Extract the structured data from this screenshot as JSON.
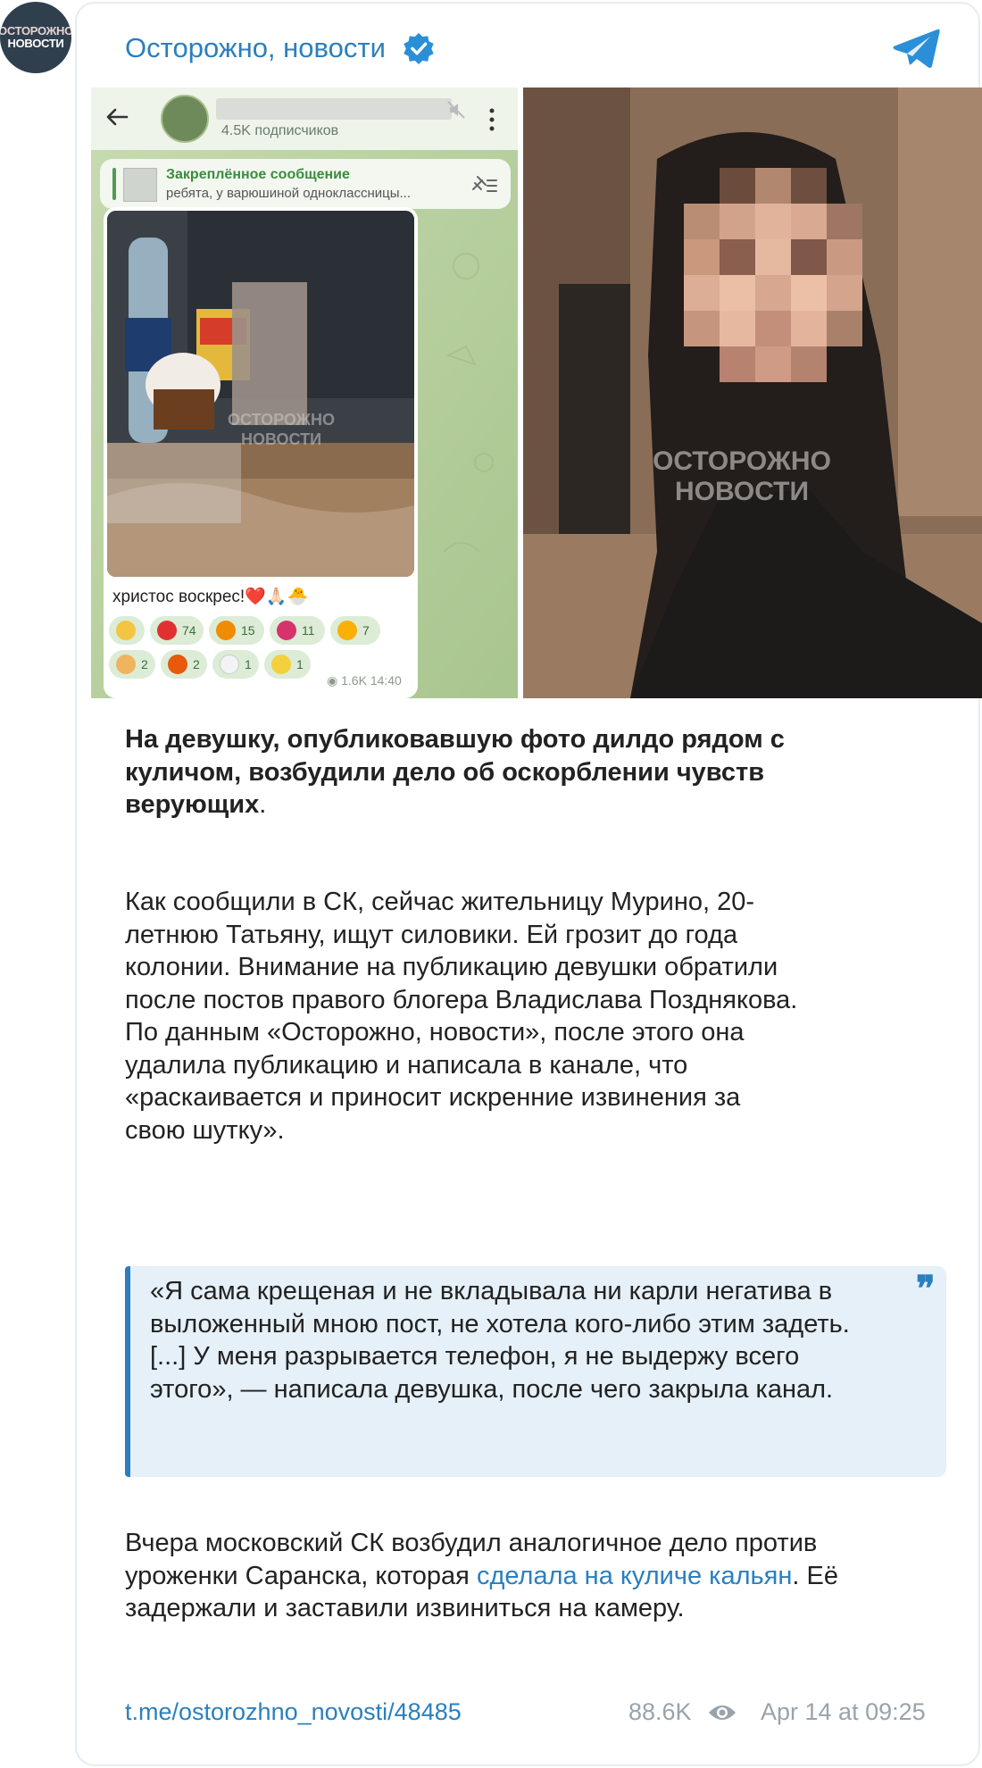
{
  "channel": {
    "avatar_line1": "ОСТОРОЖНО",
    "avatar_line2": "НОВОСТИ",
    "name": "Осторожно, новости",
    "verified_icon": "verified-badge-icon",
    "platform_icon": "telegram-icon"
  },
  "embedded_screenshot": {
    "subscribers": "4.5K подписчиков",
    "pinned_title": "Закреплённое сообщение",
    "pinned_text": "ребята, у варюшиной одноклассницы...",
    "caption": "христос воскрес!❤️🙏🏻🐣",
    "watermark": "ОСТОРОЖНО НОВОСТИ",
    "reactions": [
      {
        "emoji": "⭐",
        "count": "",
        "color": "#f4c542"
      },
      {
        "emoji": "❤",
        "count": "74",
        "color": "#e03131"
      },
      {
        "emoji": "🔥",
        "count": "15",
        "color": "#f08c00"
      },
      {
        "emoji": "💋",
        "count": "11",
        "color": "#d6336c"
      },
      {
        "emoji": "😻",
        "count": "7",
        "color": "#fab005"
      },
      {
        "emoji": "✍",
        "count": "2",
        "color": "#f2b35f"
      },
      {
        "emoji": "🍓",
        "count": "2",
        "color": "#e8590c"
      },
      {
        "emoji": "👻",
        "count": "1",
        "color": "#e9ecef"
      },
      {
        "emoji": "🌝",
        "count": "1",
        "color": "#f4d03f"
      }
    ],
    "views": "1.6K",
    "time": "14:40"
  },
  "photo_watermark": {
    "line1": "ОСТОРОЖНО",
    "line2": "НОВОСТИ"
  },
  "post": {
    "title": "На девушку, опубликовавшую фото дилдо рядом с куличом, возбудили дело об оскорблении чувств верующих",
    "title_end": ".",
    "paragraph1": "Как сообщили в СК, сейчас жительницу Мурино, 20-летнюю Татьяну, ищут силовики. Ей грозит до года колонии. Внимание на публикацию девушки обратили после постов правого блогера Владислава Позднякова. По данным «Осторожно, новости», после этого она удалила публикацию и написала в канале, что «раскаивается и приносит искренние извинения за свою шутку».",
    "quote": "«Я сама крещеная и не вкладывала ни карли негатива в выложенный мною пост, не хотела кого-либо этим задеть. [...] У меня разрывается телефон, я не выдержу всего этого», — написала девушка, после чего закрыла канал.",
    "paragraph2_start": "Вчера московский СК возбудил аналогичное дело против уроженки Саранска, которая ",
    "paragraph2_link": "сделала на куличе кальян",
    "paragraph2_end": ". Её задержали и заставили извиниться на камеру."
  },
  "footer": {
    "link": "t.me/ostorozhno_novosti/48485",
    "views": "88.6K",
    "date": "Apr 14 at 09:25"
  }
}
